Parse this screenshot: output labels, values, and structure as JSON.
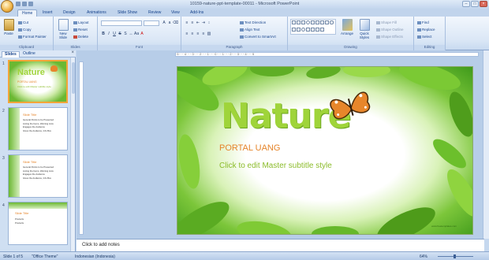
{
  "window": {
    "title": "10159-nature-ppt-template-00011 - Microsoft PowerPoint"
  },
  "tabs": [
    "Home",
    "Insert",
    "Design",
    "Animations",
    "Slide Show",
    "Review",
    "View",
    "Add-Ins"
  ],
  "ribbon": {
    "clipboard": {
      "label": "Clipboard",
      "paste": "Paste",
      "cut": "Cut",
      "copy": "Copy",
      "format_painter": "Format Painter"
    },
    "slides": {
      "label": "Slides",
      "new_slide": "New Slide",
      "layout": "Layout",
      "reset": "Reset",
      "delete": "Delete"
    },
    "font": {
      "label": "Font"
    },
    "paragraph": {
      "label": "Paragraph",
      "text_direction": "Text Direction",
      "align_text": "Align Text",
      "convert_smartart": "Convert to SmartArt"
    },
    "drawing": {
      "label": "Drawing",
      "arrange": "Arrange",
      "quick_styles": "Quick Styles",
      "shape_fill": "Shape Fill",
      "shape_outline": "Shape Outline",
      "shape_effects": "Shape Effects"
    },
    "editing": {
      "label": "Editing",
      "find": "Find",
      "replace": "Replace",
      "select": "Select"
    }
  },
  "left_pane": {
    "tabs": [
      "Slides",
      "Outline"
    ],
    "close": "×",
    "thumbnails": [
      {
        "num": "1",
        "title": "Nature",
        "sub1": "PORTAL UANG",
        "sub2": "Click to edit Master subtitle style"
      },
      {
        "num": "2",
        "title": "Slide Title",
        "bullets": [
          "General Points to be Presented",
          "Listing the Items, Warning Lists",
          "Engages the Audience",
          "Gives the Audience, Info Box"
        ]
      },
      {
        "num": "3",
        "title": "Slide Title",
        "bullets": [
          "General Points to be Presented",
          "Listing the Items, Warning Lists",
          "Engages the Audience",
          "Gives the Audience, Info Box"
        ]
      },
      {
        "num": "4",
        "title": "Slide Title",
        "bullets": [
          "Products",
          "Products"
        ]
      }
    ]
  },
  "ruler": "·5·····4·····3·····2·····1·····0·····1·····2·····3·····4·····5",
  "slide": {
    "title": "Nature",
    "subtitle": "PORTAL UANG",
    "subtitle2": "Click to edit Master subtitle style",
    "footer": "www.freetemplates.com"
  },
  "notes": {
    "placeholder": "Click to add notes"
  },
  "status": {
    "slide_info": "Slide 1 of 5",
    "theme": "\"Office Theme\"",
    "language": "Indonesian (Indonesia)",
    "zoom": "64%"
  },
  "colors": {
    "title_green": "#9fd43a",
    "subtitle_orange": "#e5842a",
    "subtitle_green": "#8cbc2b",
    "selection_orange": "#f4a53a"
  }
}
